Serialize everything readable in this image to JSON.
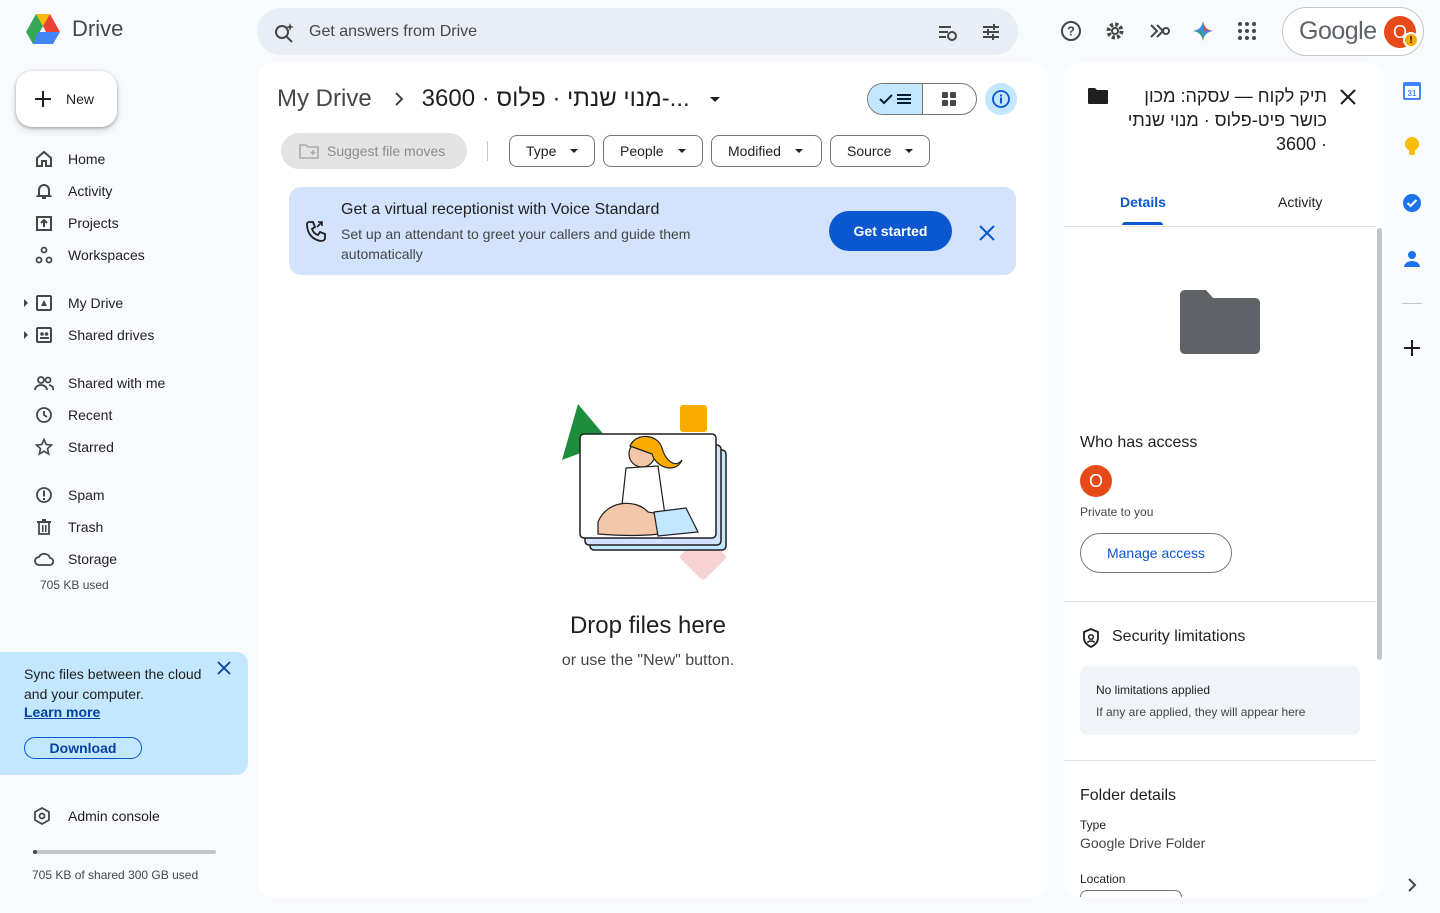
{
  "header": {
    "app_name": "Drive",
    "search_placeholder": "Get answers from Drive",
    "google_label": "Google",
    "avatar_initial": "O",
    "avatar_warning": "!"
  },
  "sidebar": {
    "new_label": "New",
    "items": [
      {
        "label": "Home",
        "icon": "home-icon"
      },
      {
        "label": "Activity",
        "icon": "bell-icon"
      },
      {
        "label": "Projects",
        "icon": "projects-icon"
      },
      {
        "label": "Workspaces",
        "icon": "workspaces-icon"
      },
      {
        "label": "My Drive",
        "icon": "my-drive-icon"
      },
      {
        "label": "Shared drives",
        "icon": "shared-drives-icon"
      },
      {
        "label": "Shared with me",
        "icon": "people-icon"
      },
      {
        "label": "Recent",
        "icon": "clock-icon"
      },
      {
        "label": "Starred",
        "icon": "star-icon"
      },
      {
        "label": "Spam",
        "icon": "spam-icon"
      },
      {
        "label": "Trash",
        "icon": "trash-icon"
      },
      {
        "label": "Storage",
        "icon": "cloud-icon"
      }
    ],
    "storage_used": "705 KB used",
    "sync": {
      "text": "Sync files between the cloud and your computer.",
      "link": "Learn more",
      "download": "Download"
    },
    "admin_console": "Admin console",
    "quota_text": "705 KB of shared 300 GB used",
    "quota_fraction": 0.01
  },
  "main": {
    "breadcrumb_root": "My Drive",
    "breadcrumb_current": "3600 · מנוי שנתי · פלוס-...",
    "suggest_label": "Suggest file moves",
    "filters": [
      "Type",
      "People",
      "Modified",
      "Source"
    ],
    "banner": {
      "title": "Get a virtual receptionist with Voice Standard",
      "subtitle": "Set up an attendant to greet your callers and guide them automatically",
      "button": "Get started"
    },
    "empty": {
      "title": "Drop files here",
      "subtitle": "or use the \"New\" button."
    }
  },
  "details": {
    "title": "תיק לקוח — עסקה: מכון כושר פיט-פלוס · מנוי שנתי · 3600",
    "tabs": [
      "Details",
      "Activity"
    ],
    "who_has_access": "Who has access",
    "owner_initial": "O",
    "private_text": "Private to you",
    "manage_access": "Manage access",
    "security_title": "Security limitations",
    "security_box_title": "No limitations applied",
    "security_box_sub": "If any are applied, they will appear here",
    "folder_details": "Folder details",
    "type_label": "Type",
    "type_value": "Google Drive Folder",
    "location_label": "Location"
  },
  "rail": {
    "calendar_day": "31"
  },
  "colors": {
    "accent": "#0b57d0",
    "selected": "#c2e7ff",
    "banner": "#d3e3fd",
    "avatar": "#e64a19"
  }
}
